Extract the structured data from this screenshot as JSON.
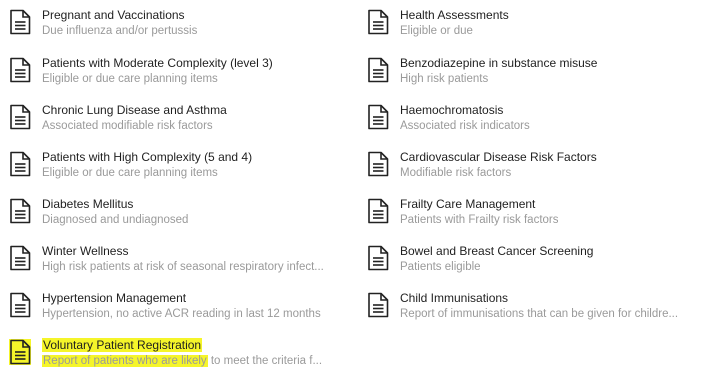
{
  "left_items": [
    {
      "title": "Pregnant and Vaccinations",
      "subtitle": "Due  influenza  and/or pertussis"
    },
    {
      "title": "Patients with Moderate Complexity (level 3)",
      "subtitle": "Eligible or due care planning items"
    },
    {
      "title": "Chronic Lung Disease and Asthma",
      "subtitle": "Associated modifiable risk factors"
    },
    {
      "title": "Patients with High Complexity (5 and 4)",
      "subtitle": "Eligible or due care planning items"
    },
    {
      "title": "Diabetes Mellitus",
      "subtitle": "Diagnosed and undiagnosed"
    },
    {
      "title": "Winter Wellness",
      "subtitle": "High risk patients at risk of seasonal respiratory infect..."
    },
    {
      "title": "Hypertension Management",
      "subtitle": "Hypertension, no active ACR reading in last 12 months"
    }
  ],
  "right_items": [
    {
      "title": "Health Assessments",
      "subtitle": "Eligible or due"
    },
    {
      "title": "Benzodiazepine in substance misuse",
      "subtitle": "High risk patients"
    },
    {
      "title": "Haemochromatosis",
      "subtitle": "Associated risk indicators"
    },
    {
      "title": "Cardiovascular Disease Risk Factors",
      "subtitle": "Modifiable risk factors"
    },
    {
      "title": "Frailty Care Management",
      "subtitle": "Patients with Frailty risk factors"
    },
    {
      "title": "Bowel and Breast Cancer Screening",
      "subtitle": "Patients eligible"
    },
    {
      "title": "Child Immunisations",
      "subtitle": "Report of immunisations that can be given for childre..."
    }
  ],
  "highlighted_item": {
    "title": "Voluntary Patient Registration",
    "subtitle_highlighted": "Report of patients who are likely",
    "subtitle_rest": " to meet the criteria f..."
  },
  "colors": {
    "highlight": "#f5f52a",
    "title": "#1f1f1f",
    "subtitle": "#9a9a9a"
  },
  "icon": "document-icon"
}
